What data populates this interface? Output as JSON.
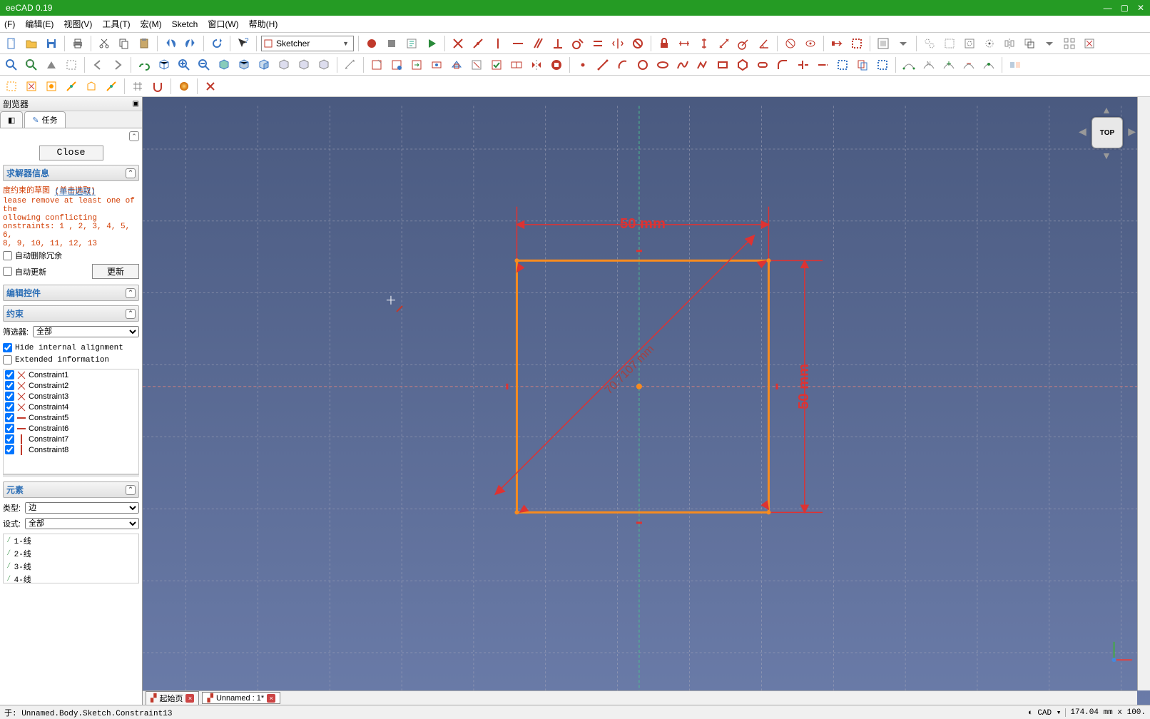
{
  "title": "eeCAD 0.19",
  "menu": {
    "file": "(F)",
    "edit": "编辑(E)",
    "view": "视图(V)",
    "tools": "工具(T)",
    "macro": "宏(M)",
    "sketch": "Sketch",
    "window": "窗口(W)",
    "help": "帮助(H)"
  },
  "workbench": {
    "label": "Sketcher"
  },
  "side": {
    "title": "剖览器",
    "tabs": {
      "model": "",
      "task": "任务"
    },
    "close": "Close"
  },
  "solver": {
    "header": "求解器信息",
    "line1": "度约束的草图 (单击选取)",
    "msg1": "lease remove at least one of the",
    "msg2": "ollowing conflicting",
    "msg3": "onstraints: 1 , 2, 3, 4, 5, 6,",
    "msg4": " 8, 9, 10, 11, 12, 13",
    "auto_del": "自动删除冗余",
    "auto_upd": "自动更新",
    "update": "更新"
  },
  "edit_ctrl": {
    "header": "编辑控件"
  },
  "constraints": {
    "header": "约束",
    "filter_label": "筛选器:",
    "filter_value": "全部",
    "hide": "Hide internal alignment",
    "ext": "Extended information",
    "items": [
      "Constraint1",
      "Constraint2",
      "Constraint3",
      "Constraint4",
      "Constraint5",
      "Constraint6",
      "Constraint7",
      "Constraint8"
    ]
  },
  "elements": {
    "header": "元素",
    "type_label": "类型:",
    "type_value": "边",
    "mode_label": "设式:",
    "mode_value": "全部",
    "items": [
      "1-线",
      "2-线",
      "3-线",
      "4-线"
    ]
  },
  "sketch": {
    "dim_h": "50 mm",
    "dim_v": "50 mm",
    "dim_diag": "70.7107 mm"
  },
  "navcube": {
    "label": "TOP"
  },
  "doctabs": {
    "start": "起始页",
    "doc": "Unnamed : 1*"
  },
  "status": {
    "left": "于:  Unnamed.Body.Sketch.Constraint13",
    "nav": "CAD",
    "coords": "174.04 mm x 100."
  }
}
